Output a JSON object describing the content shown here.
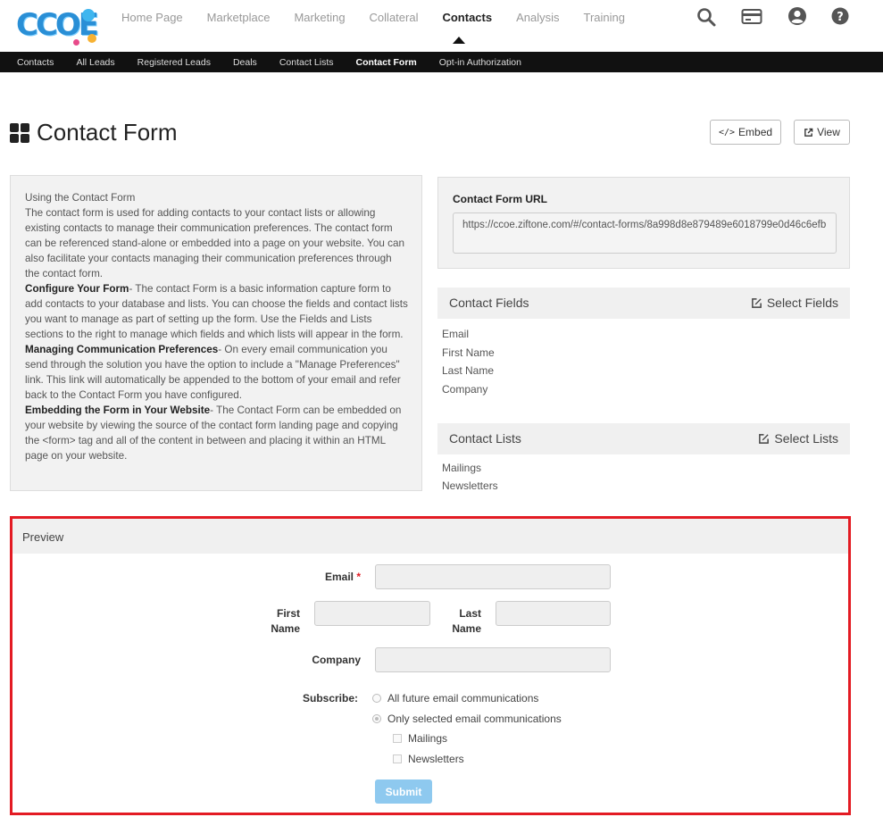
{
  "logo": {
    "text": "CCOE"
  },
  "mainnav": [
    "Home Page",
    "Marketplace",
    "Marketing",
    "Collateral",
    "Contacts",
    "Analysis",
    "Training"
  ],
  "subnav": [
    "Contacts",
    "All Leads",
    "Registered Leads",
    "Deals",
    "Contact Lists",
    "Contact Form",
    "Opt-in Authorization"
  ],
  "page": {
    "title": "Contact Form",
    "embed_label": "Embed",
    "view_label": "View"
  },
  "info": {
    "heading": "Using the Contact Form",
    "intro": "The contact form is used for adding contacts to your contact lists or allowing existing contacts to manage their communication preferences. The contact form can be referenced stand-alone or embedded into a page on your website. You can also facilitate your contacts managing their communication preferences through the contact form.",
    "configure_title": "Configure Your Form",
    "configure_text": "- The contact Form is a basic information capture form to add contacts to your database and lists. You can choose the fields and contact lists you want to manage as part of setting up the form. Use the Fields and Lists sections to the right to manage which fields and which lists will appear in the form.",
    "managing_title": "Managing Communication Preferences",
    "managing_text": "- On every email communication you send through the solution you have the option to include a \"Manage Preferences\" link. This link will automatically be appended to the bottom of your email and refer back to the Contact Form you have configured.",
    "embedding_title": "Embedding the Form in Your Website",
    "embedding_text": "- The Contact Form can be embedded on your website by viewing the source of the contact form landing page and copying the <form> tag and all of the content in between and placing it within an HTML page on your website."
  },
  "url": {
    "label": "Contact Form URL",
    "value": "https://ccoe.ziftone.com/#/contact-forms/8a998d8e879489e6018799e0d46c6efb"
  },
  "fields": {
    "title": "Contact Fields",
    "link": "Select Fields",
    "items": [
      "Email",
      "First Name",
      "Last Name",
      "Company"
    ]
  },
  "lists": {
    "title": "Contact Lists",
    "link": "Select Lists",
    "items": [
      "Mailings",
      "Newsletters"
    ]
  },
  "preview": {
    "title": "Preview",
    "email_label": "Email",
    "required_mark": "*",
    "first_label_1": "First",
    "first_label_2": "Name",
    "last_label_1": "Last",
    "last_label_2": "Name",
    "company_label": "Company",
    "subscribe_label": "Subscribe:",
    "opt_all": "All future email communications",
    "opt_selected": "Only selected email communications",
    "list_mailings": "Mailings",
    "list_newsletters": "Newsletters",
    "submit_label": "Submit"
  },
  "colors": {
    "accent_red": "#e31b23",
    "submit_blue": "#8ec9ef",
    "logo_blue": "#2a8fd6"
  }
}
